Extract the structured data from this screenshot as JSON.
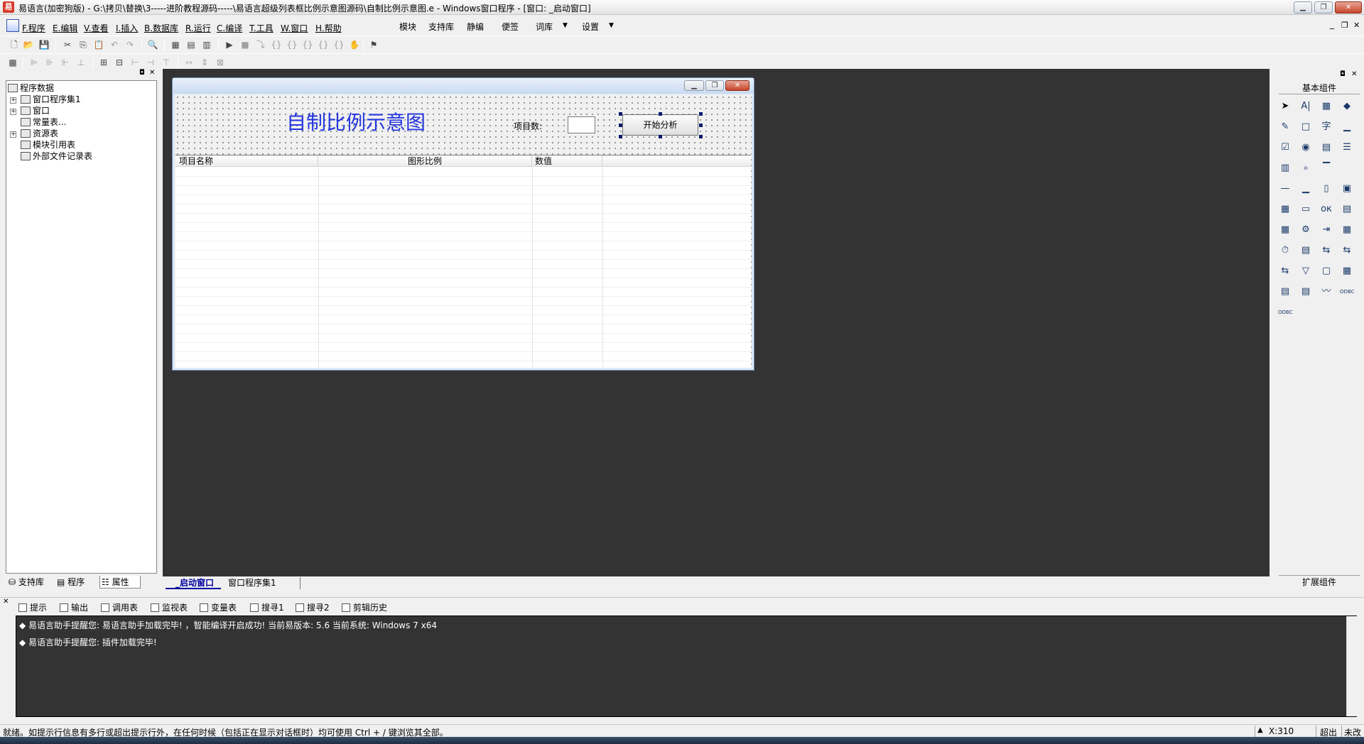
{
  "window": {
    "title": "易语言(加密狗版) - G:\\拷贝\\替换\\3-----进阶教程源码-----\\易语言超级列表框比例示意图源码\\自制比例示意图.e - Windows窗口程序 - [窗口: _启动窗口]",
    "minimize": "▁",
    "maximize": "❐",
    "close": "✕"
  },
  "menu": {
    "items": [
      "F.程序",
      "E.编辑",
      "V.查看",
      "I.插入",
      "B.数据库",
      "R.运行",
      "C.编译",
      "T.工具",
      "W.窗口",
      "H.帮助"
    ],
    "right_items": [
      "模块",
      "支持库",
      "静编",
      "便签",
      "词库",
      "设置"
    ],
    "dropdown_glyph": "▼",
    "mdi_min": "_",
    "mdi_restore": "❐",
    "mdi_close": "✕"
  },
  "left_panel": {
    "tree": {
      "root": "程序数据",
      "items": [
        "窗口程序集1",
        "窗口",
        "常量表...",
        "资源表",
        "模块引用表",
        "外部文件记录表"
      ],
      "expanders": [
        "+",
        "+",
        "+"
      ]
    },
    "tabs": [
      "支持库",
      "程序",
      "属性"
    ]
  },
  "designer": {
    "form_title": "自制比例示意图",
    "label_count": "项目数:",
    "button_start": "开始分析",
    "list_columns": [
      "项目名称",
      "图形比例",
      "数值"
    ]
  },
  "workspace_tabs": [
    "_启动窗口",
    "窗口程序集1"
  ],
  "right_panel": {
    "basic": "基本组件",
    "extended": "扩展组件",
    "component_glyphs": [
      "➤",
      "A|",
      "▦",
      "◆",
      "✎",
      "□",
      "字",
      "▁",
      "☑",
      "◉",
      "▤",
      "☰",
      "▥",
      "ılı",
      "▔",
      "",
      "—",
      "▁",
      "▯",
      "▣",
      "▦",
      "▭",
      "ок",
      "▤",
      "▦",
      "⚙",
      "⇥",
      "▦",
      "⏱",
      "▤",
      "⇆",
      "⇆",
      "⇆",
      "▽",
      "▢",
      "▦",
      "▤",
      "▤",
      "〰",
      "ODBC",
      "ODBC"
    ]
  },
  "output_tabs": [
    "提示",
    "输出",
    "调用表",
    "监视表",
    "变量表",
    "搜寻1",
    "搜寻2",
    "剪辑历史"
  ],
  "output_lines": [
    "◆ 易语言助手提醒您: 易语言助手加载完毕! ，智能编译开启成功! 当前易版本: 5.6 当前系统: Windows 7 x64",
    "◆ 易语言助手提醒您: 插件加载完毕!"
  ],
  "status": {
    "message": "就绪。如提示行信息有多行或超出提示行外，在任何时候（包括正在显示对话框时）均可使用 Ctrl + / 键浏览其全部。",
    "coord": "X:310",
    "mode": "超出",
    "record": "未改"
  }
}
